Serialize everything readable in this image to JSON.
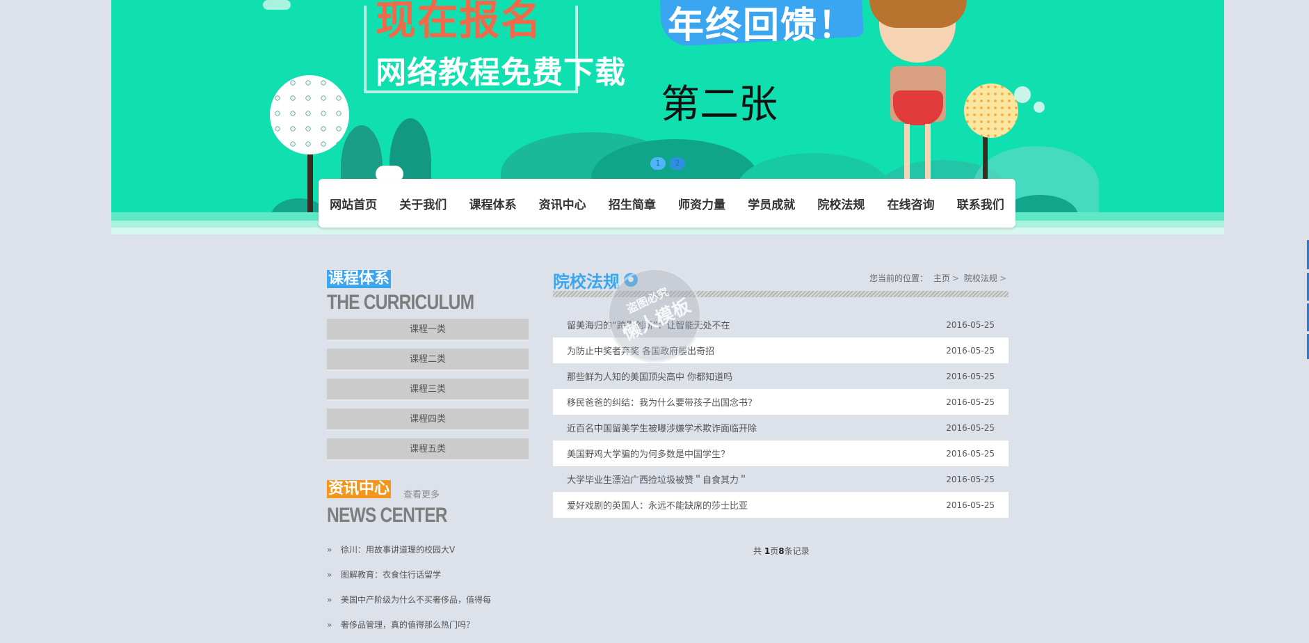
{
  "banner": {
    "promo_title": "现在报名",
    "promo_subtitle": "网络教程免费下载",
    "ribbon_text": "年终回馈！",
    "slide_label": "第二张",
    "slide_dots": [
      "1",
      "2"
    ],
    "active_slide": 2,
    "colors": {
      "background": "#10dfb0",
      "ribbon": "#3aa5f0",
      "promo_title": "#f06a4a"
    }
  },
  "nav": {
    "items": [
      {
        "label": "网站首页"
      },
      {
        "label": "关于我们"
      },
      {
        "label": "课程体系"
      },
      {
        "label": "资讯中心"
      },
      {
        "label": "招生简章"
      },
      {
        "label": "师资力量"
      },
      {
        "label": "学员成就"
      },
      {
        "label": "院校法规"
      },
      {
        "label": "在线咨询"
      },
      {
        "label": "联系我们"
      }
    ]
  },
  "sidebar": {
    "curriculum_title": "课程体系",
    "curriculum_en": "THE CURRICULUM",
    "categories": [
      "课程一类",
      "课程二类",
      "课程三类",
      "课程四类",
      "课程五类"
    ],
    "news_title": "资讯中心",
    "news_more": "查看更多",
    "news_en": "NEWS CENTER",
    "news_items": [
      "徐川：用故事讲道理的校园大V",
      "图解教育：衣食住行话留学",
      "美国中产阶级为什么不买奢侈品，值得每",
      "奢侈品管理，真的值得那么热门吗？"
    ]
  },
  "main": {
    "title": "院校法规",
    "breadcrumb": {
      "prefix": "您当前的位置：",
      "home": "主页",
      "current": "院校法规",
      "separator": ">"
    },
    "articles": [
      {
        "title": "留美海归的“跨界创新”：让智能无处不在",
        "date": "2016-05-25"
      },
      {
        "title": "为防止中奖者弃奖 各国政府屡出奇招",
        "date": "2016-05-25"
      },
      {
        "title": "那些鲜为人知的美国顶尖高中 你都知道吗",
        "date": "2016-05-25"
      },
      {
        "title": "移民爸爸的纠结：我为什么要带孩子出国念书？",
        "date": "2016-05-25"
      },
      {
        "title": "近百名中国留美学生被曝涉嫌学术欺诈面临开除",
        "date": "2016-05-25"
      },
      {
        "title": "美国野鸡大学骗的为何多数是中国学生？",
        "date": "2016-05-25"
      },
      {
        "title": "大学毕业生漂泊广西捡垃圾被赞＂自食其力＂",
        "date": "2016-05-25"
      },
      {
        "title": "爱好戏剧的英国人：永远不能缺席的莎士比亚",
        "date": "2016-05-25"
      }
    ],
    "pager": {
      "prefix": "共 ",
      "pages": "1",
      "mid": "页",
      "records": "8",
      "suffix": "条记录"
    }
  },
  "watermark": {
    "line1": "盗图必究",
    "line2": "懒人模板"
  }
}
